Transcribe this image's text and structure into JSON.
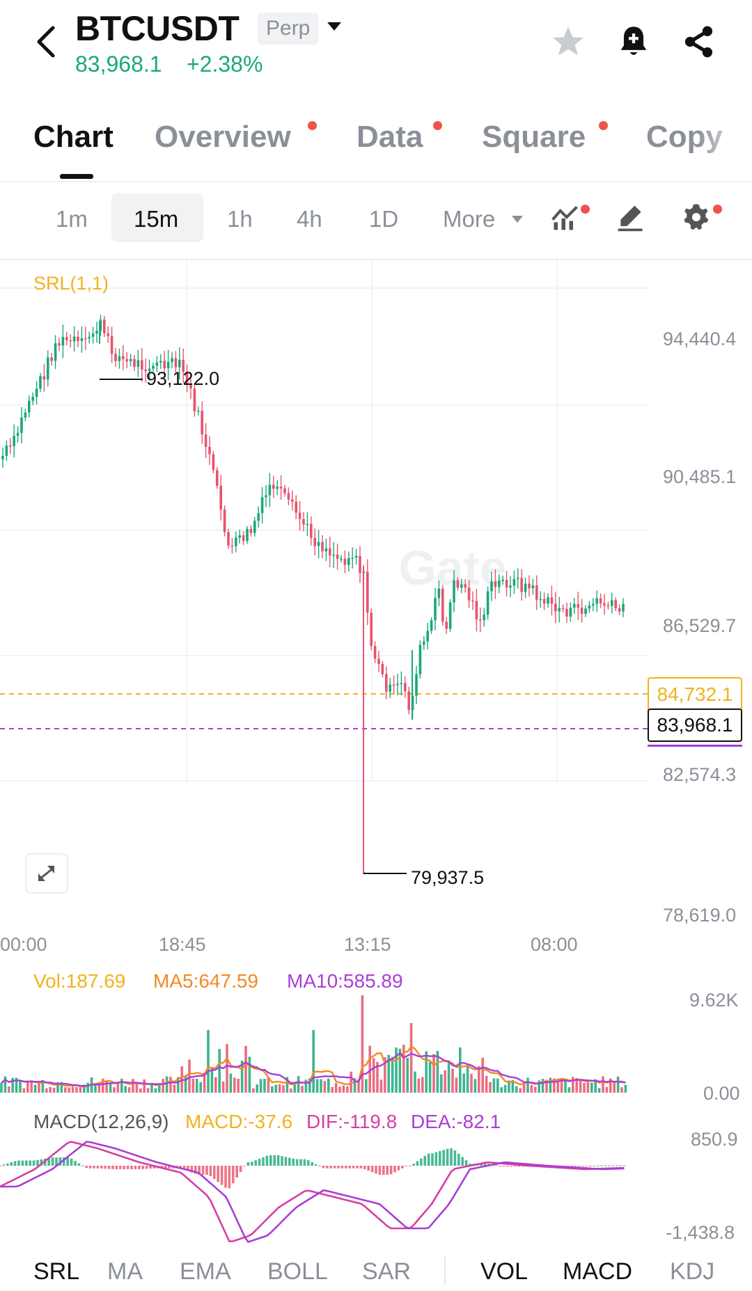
{
  "header": {
    "symbol": "BTCUSDT",
    "contract_badge": "Perp",
    "price": "83,968.1",
    "change": "+2.38%",
    "icons": [
      "back-icon",
      "dropdown-caret-icon",
      "star-icon",
      "bell-plus-icon",
      "share-icon"
    ]
  },
  "tabs": [
    {
      "label": "Chart",
      "active": true,
      "dot": false
    },
    {
      "label": "Overview",
      "active": false,
      "dot": true
    },
    {
      "label": "Data",
      "active": false,
      "dot": true
    },
    {
      "label": "Square",
      "active": false,
      "dot": true
    },
    {
      "label": "Copy",
      "active": false,
      "dot": false
    }
  ],
  "intervals": {
    "options": [
      "1m",
      "15m",
      "1h",
      "4h",
      "1D",
      "More"
    ],
    "selected": "15m",
    "tool_icons": [
      "indicator-icon",
      "drawing-pen-icon",
      "settings-gear-icon"
    ]
  },
  "chart": {
    "indicator_label": "SRL(1,1)",
    "watermark": "Gate",
    "y_axis": [
      "94,440.4",
      "90,485.1",
      "86,529.7",
      "82,574.3",
      "78,619.0"
    ],
    "x_axis": [
      "00:00",
      "18:45",
      "13:15",
      "08:00"
    ],
    "high_marker": "93,122.0",
    "low_marker": "79,937.5",
    "price_tag_high": "84,732.1",
    "price_tag_last": "83,968.1"
  },
  "volume": {
    "vol_label": "Vol:187.69",
    "ma5_label": "MA5:647.59",
    "ma10_label": "MA10:585.89",
    "y_max": "9.62K",
    "y_min": "0.00"
  },
  "macd": {
    "title": "MACD(12,26,9)",
    "macd_label": "MACD:-37.6",
    "dif_label": "DIF:-119.8",
    "dea_label": "DEA:-82.1",
    "y_max": "850.9",
    "y_min": "-1,438.8"
  },
  "indicator_tabs": {
    "main": [
      "SRL",
      "MA",
      "EMA",
      "BOLL",
      "SAR"
    ],
    "sub": [
      "VOL",
      "MACD",
      "KDJ"
    ]
  },
  "colors": {
    "up": "#1aa87a",
    "down": "#e8536b",
    "accent_yellow": "#f2b21c",
    "macd_purple": "#a93ed6",
    "ma5_orange": "#f08a24",
    "tab_dot": "#f0524d"
  }
}
